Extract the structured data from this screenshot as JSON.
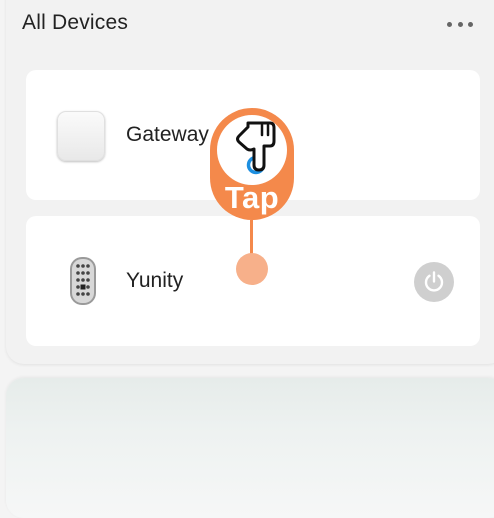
{
  "header": {
    "title": "All Devices",
    "more_icon": "more-dots-icon"
  },
  "devices": [
    {
      "name": "Gateway",
      "icon": "gateway-icon"
    },
    {
      "name": "Yunity",
      "icon": "smart-lock-icon",
      "action_icon": "power-icon"
    }
  ],
  "overlay": {
    "label": "Tap",
    "icon": "tap-hand-icon",
    "color": "#f4894b"
  },
  "colors": {
    "background": "#f4f4f4",
    "card": "#ffffff",
    "power_button": "#cfcfcf"
  }
}
